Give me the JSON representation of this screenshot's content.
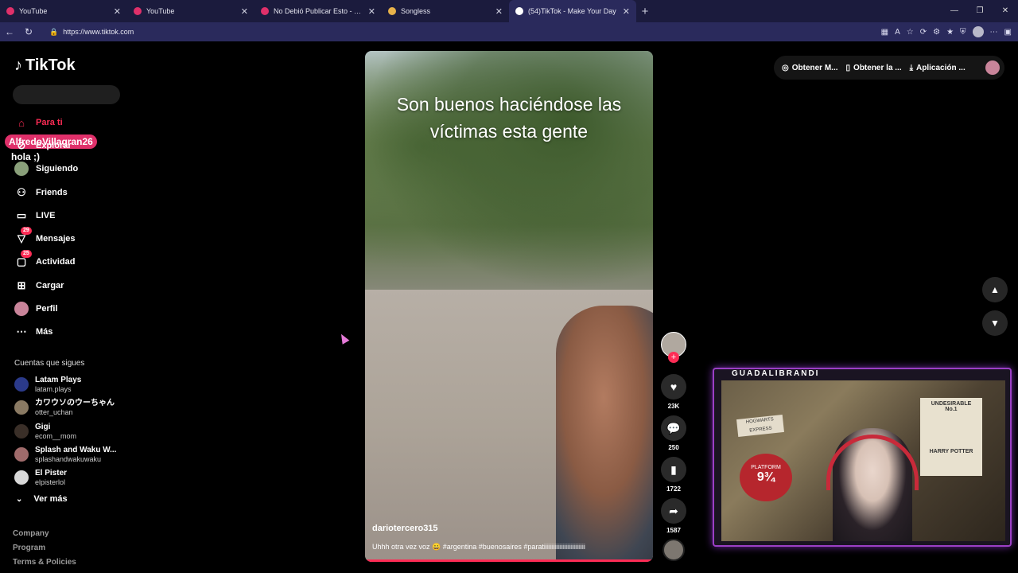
{
  "browser": {
    "tabs": [
      {
        "title": "YouTube",
        "color": "#e0306a"
      },
      {
        "title": "YouTube",
        "color": "#e0306a"
      },
      {
        "title": "No Debió Publicar Esto - YouTube",
        "color": "#e0306a"
      },
      {
        "title": "Songless",
        "color": "#e8b24a"
      },
      {
        "title": "(54)TikTok - Make Your Day",
        "color": "#ffffff"
      }
    ],
    "url": "https://www.tiktok.com"
  },
  "tiktok": {
    "logo": "TikTok",
    "overlay_user": "AlfredoVillagran26",
    "overlay_msg": "hola ;)",
    "nav": [
      {
        "label": "Para ti",
        "icon": "home-icon"
      },
      {
        "label": "Explorar",
        "icon": "compass-icon"
      },
      {
        "label": "Siguiendo",
        "icon": "following-avatar"
      },
      {
        "label": "Friends",
        "icon": "friends-icon"
      },
      {
        "label": "LIVE",
        "icon": "live-icon"
      },
      {
        "label": "Mensajes",
        "icon": "messages-icon",
        "badge": "29"
      },
      {
        "label": "Actividad",
        "icon": "activity-icon",
        "badge": "25"
      },
      {
        "label": "Cargar",
        "icon": "upload-icon"
      },
      {
        "label": "Perfil",
        "icon": "profile-avatar"
      },
      {
        "label": "Más",
        "icon": "more-icon"
      }
    ],
    "following_title": "Cuentas que sigues",
    "following": [
      {
        "name": "Latam Plays",
        "handle": "latam.plays",
        "color": "#2b3a8a"
      },
      {
        "name": "カワウソのウーちゃん",
        "handle": "otter_uchan",
        "color": "#8a7a63"
      },
      {
        "name": "Gigi",
        "handle": "ecom__mom",
        "color": "#3a2f28"
      },
      {
        "name": "Splash and Waku W...",
        "handle": "splashandwakuwaku",
        "color": "#a06b6b"
      },
      {
        "name": "El Pister",
        "handle": "elpisterlol",
        "color": "#d8d8d8"
      }
    ],
    "ver_mas": "Ver más",
    "footer": [
      "Company",
      "Program",
      "Terms & Policies"
    ],
    "top_actions": [
      "Obtener M...",
      "Obtener la ...",
      "Aplicación ..."
    ],
    "video": {
      "caption_line1": "Son buenos haciéndose las",
      "caption_line2": "víctimas esta gente",
      "author": "dariotercero315",
      "description": "Uhhh otra vez voz 😀 #argentina #buenosaires #paratiiiiiiiiiiiiiiiiiiiiiiiiii"
    },
    "actions": {
      "likes": "23K",
      "comments": "250",
      "saves": "1722",
      "shares": "1587"
    }
  },
  "stream": {
    "label": "GUADALIBRANDI",
    "sign_hogwarts": "HOGWARTS EXPRESS",
    "sign_undesirable_1": "UNDESIRABLE",
    "sign_undesirable_2": "No.1",
    "sign_undesirable_3": "HARRY POTTER",
    "platform_top": "PLATFORM",
    "platform_num": "9¾"
  }
}
